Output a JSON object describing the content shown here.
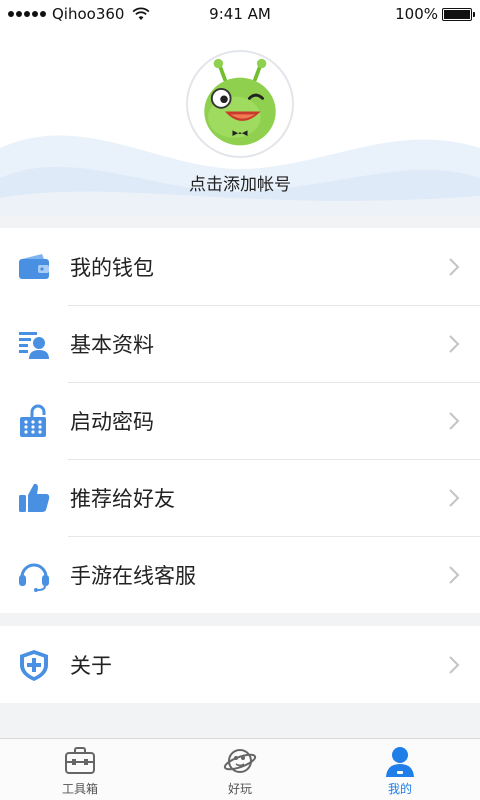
{
  "status_bar": {
    "carrier": "Qihoo360",
    "time": "9:41 AM",
    "battery": "100%",
    "battery_level": 1.0
  },
  "profile": {
    "avatar_icon": "green-alien-mascot-icon",
    "account_link": "点击添加帐号"
  },
  "menu": {
    "items": [
      {
        "label": "我的钱包",
        "icon": "wallet-icon"
      },
      {
        "label": "基本资料",
        "icon": "profile-card-icon"
      },
      {
        "label": "启动密码",
        "icon": "keypad-lock-icon"
      },
      {
        "label": "推荐给好友",
        "icon": "thumbs-up-icon"
      },
      {
        "label": "手游在线客服",
        "icon": "headset-icon"
      }
    ],
    "about": {
      "label": "关于",
      "icon": "shield-plus-icon"
    }
  },
  "tabs": [
    {
      "label": "工具箱",
      "icon": "toolbox-icon",
      "active": false
    },
    {
      "label": "好玩",
      "icon": "planet-icon",
      "active": false
    },
    {
      "label": "我的",
      "icon": "person-icon",
      "active": true
    }
  ],
  "colors": {
    "accent": "#1f7ee8",
    "icon_blue": "#4a90e2",
    "mascot_green": "#8fd14f"
  }
}
